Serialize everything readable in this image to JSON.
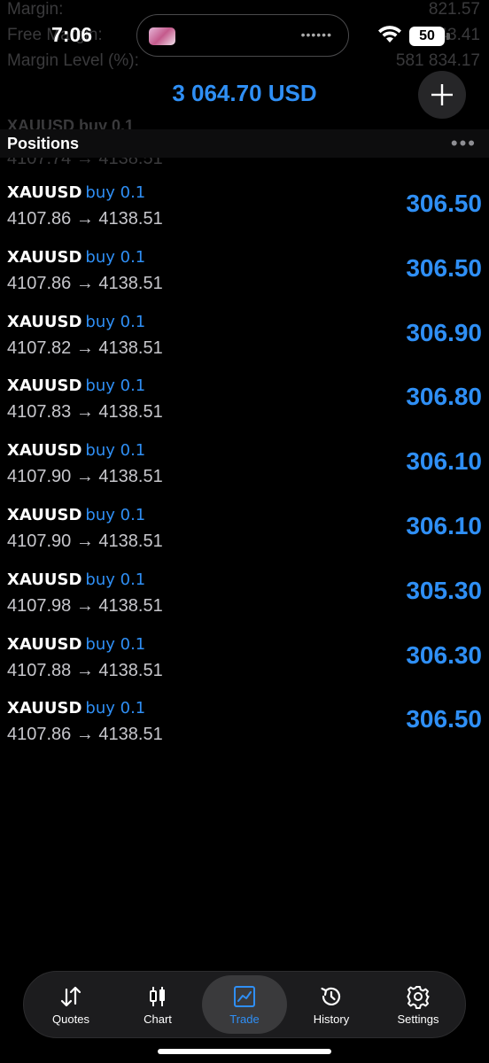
{
  "status": {
    "time": "7:06",
    "battery": "50"
  },
  "background_rows": [
    {
      "label": "Margin:",
      "value": "821.57"
    },
    {
      "label": "Free Margin:",
      "value": "3 243.41"
    },
    {
      "label": "Margin Level (%):",
      "value": "581 834.17"
    }
  ],
  "header": {
    "balance": "3 064.70 USD"
  },
  "ghost": {
    "row_top": "XAUUSD buy 0.1",
    "row_bottom": "4107.74 → 4138.51"
  },
  "section": {
    "title": "Positions"
  },
  "positions": [
    {
      "symbol": "XAUUSD",
      "side": "buy 0.1",
      "prices": "4107.86 → 4138.51",
      "profit": "306.50"
    },
    {
      "symbol": "XAUUSD",
      "side": "buy 0.1",
      "prices": "4107.86 → 4138.51",
      "profit": "306.50"
    },
    {
      "symbol": "XAUUSD",
      "side": "buy 0.1",
      "prices": "4107.82 → 4138.51",
      "profit": "306.90"
    },
    {
      "symbol": "XAUUSD",
      "side": "buy 0.1",
      "prices": "4107.83 → 4138.51",
      "profit": "306.80"
    },
    {
      "symbol": "XAUUSD",
      "side": "buy 0.1",
      "prices": "4107.90 → 4138.51",
      "profit": "306.10"
    },
    {
      "symbol": "XAUUSD",
      "side": "buy 0.1",
      "prices": "4107.90 → 4138.51",
      "profit": "306.10"
    },
    {
      "symbol": "XAUUSD",
      "side": "buy 0.1",
      "prices": "4107.98 → 4138.51",
      "profit": "305.30"
    },
    {
      "symbol": "XAUUSD",
      "side": "buy 0.1",
      "prices": "4107.88 → 4138.51",
      "profit": "306.30"
    },
    {
      "symbol": "XAUUSD",
      "side": "buy 0.1",
      "prices": "4107.86 → 4138.51",
      "profit": "306.50"
    }
  ],
  "tabs": [
    {
      "label": "Quotes",
      "icon": "quotes-icon"
    },
    {
      "label": "Chart",
      "icon": "chart-icon"
    },
    {
      "label": "Trade",
      "icon": "trade-icon"
    },
    {
      "label": "History",
      "icon": "history-icon"
    },
    {
      "label": "Settings",
      "icon": "settings-icon"
    }
  ],
  "colors": {
    "accent": "#2f8ff5",
    "background": "#000000",
    "tabbar": "#1c1c1e"
  }
}
